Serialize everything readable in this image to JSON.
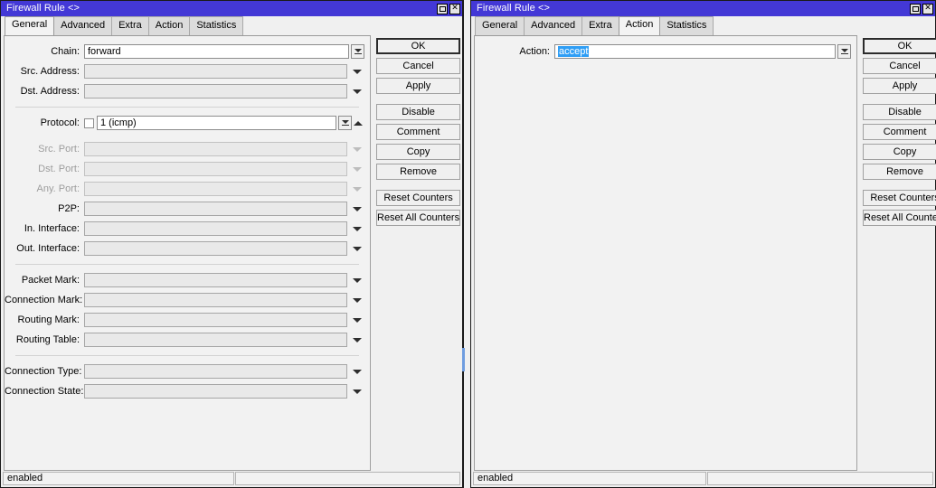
{
  "windows": [
    {
      "id": "left",
      "title": "Firewall Rule <>",
      "titlebar_color": "#4338d6",
      "controls": {
        "maximize": "□",
        "close": "✕"
      },
      "tabs": [
        {
          "label": "General",
          "active": true
        },
        {
          "label": "Advanced",
          "active": false
        },
        {
          "label": "Extra",
          "active": false
        },
        {
          "label": "Action",
          "active": false
        },
        {
          "label": "Statistics",
          "active": false
        }
      ],
      "fields": [
        {
          "label": "Chain:",
          "value": "forward",
          "state": "editable",
          "control": "combo-split"
        },
        {
          "label": "Src. Address:",
          "value": "",
          "state": "normal",
          "control": "arrow"
        },
        {
          "label": "Dst. Address:",
          "value": "",
          "state": "normal",
          "control": "arrow"
        },
        {
          "label": "Protocol:",
          "value": "1 (icmp)",
          "state": "editable",
          "control": "combo-split",
          "checkbox": true,
          "spinner": "up"
        },
        {
          "label": "Src. Port:",
          "value": "",
          "state": "disabled",
          "control": "arrow-light"
        },
        {
          "label": "Dst. Port:",
          "value": "",
          "state": "disabled",
          "control": "arrow-light"
        },
        {
          "label": "Any. Port:",
          "value": "",
          "state": "disabled",
          "control": "arrow-light"
        },
        {
          "label": "P2P:",
          "value": "",
          "state": "normal",
          "control": "arrow"
        },
        {
          "label": "In. Interface:",
          "value": "",
          "state": "normal",
          "control": "arrow"
        },
        {
          "label": "Out. Interface:",
          "value": "",
          "state": "normal",
          "control": "arrow"
        },
        {
          "label": "Packet Mark:",
          "value": "",
          "state": "normal",
          "control": "arrow"
        },
        {
          "label": "Connection Mark:",
          "value": "",
          "state": "normal",
          "control": "arrow"
        },
        {
          "label": "Routing Mark:",
          "value": "",
          "state": "normal",
          "control": "arrow"
        },
        {
          "label": "Routing Table:",
          "value": "",
          "state": "normal",
          "control": "arrow"
        },
        {
          "label": "Connection Type:",
          "value": "",
          "state": "normal",
          "control": "arrow"
        },
        {
          "label": "Connection State:",
          "value": "",
          "state": "normal",
          "control": "arrow"
        }
      ],
      "buttons": [
        {
          "label": "OK",
          "default": true
        },
        {
          "label": "Cancel",
          "default": false
        },
        {
          "label": "Apply",
          "default": false
        },
        {
          "label": "Disable",
          "default": false
        },
        {
          "label": "Comment",
          "default": false
        },
        {
          "label": "Copy",
          "default": false
        },
        {
          "label": "Remove",
          "default": false
        },
        {
          "label": "Reset Counters",
          "default": false
        },
        {
          "label": "Reset All Counters",
          "default": false
        }
      ],
      "status": {
        "left": "enabled",
        "right": ""
      }
    },
    {
      "id": "right",
      "title": "Firewall Rule <>",
      "titlebar_color": "#4338d6",
      "controls": {
        "maximize": "□",
        "close": "✕"
      },
      "tabs": [
        {
          "label": "General",
          "active": false
        },
        {
          "label": "Advanced",
          "active": false
        },
        {
          "label": "Extra",
          "active": false
        },
        {
          "label": "Action",
          "active": true
        },
        {
          "label": "Statistics",
          "active": false
        }
      ],
      "fields": [
        {
          "label": "Action:",
          "value": "accept",
          "state": "selected",
          "control": "combo-split"
        }
      ],
      "buttons": [
        {
          "label": "OK",
          "default": true
        },
        {
          "label": "Cancel",
          "default": false
        },
        {
          "label": "Apply",
          "default": false
        },
        {
          "label": "Disable",
          "default": false
        },
        {
          "label": "Comment",
          "default": false
        },
        {
          "label": "Copy",
          "default": false
        },
        {
          "label": "Remove",
          "default": false
        },
        {
          "label": "Reset Counters",
          "default": false
        },
        {
          "label": "Reset All Counters",
          "default": false
        }
      ],
      "status": {
        "left": "enabled",
        "right": ""
      }
    }
  ],
  "colors": {
    "titlebar": "#4338d6",
    "selection": "#2f9ef5",
    "window_bg": "#f0f0f0",
    "field_bg": "#e9e9e9",
    "editable_bg": "#ffffff"
  },
  "separator_after_index": [
    2,
    9,
    13
  ],
  "gap_after_index": [
    3
  ]
}
